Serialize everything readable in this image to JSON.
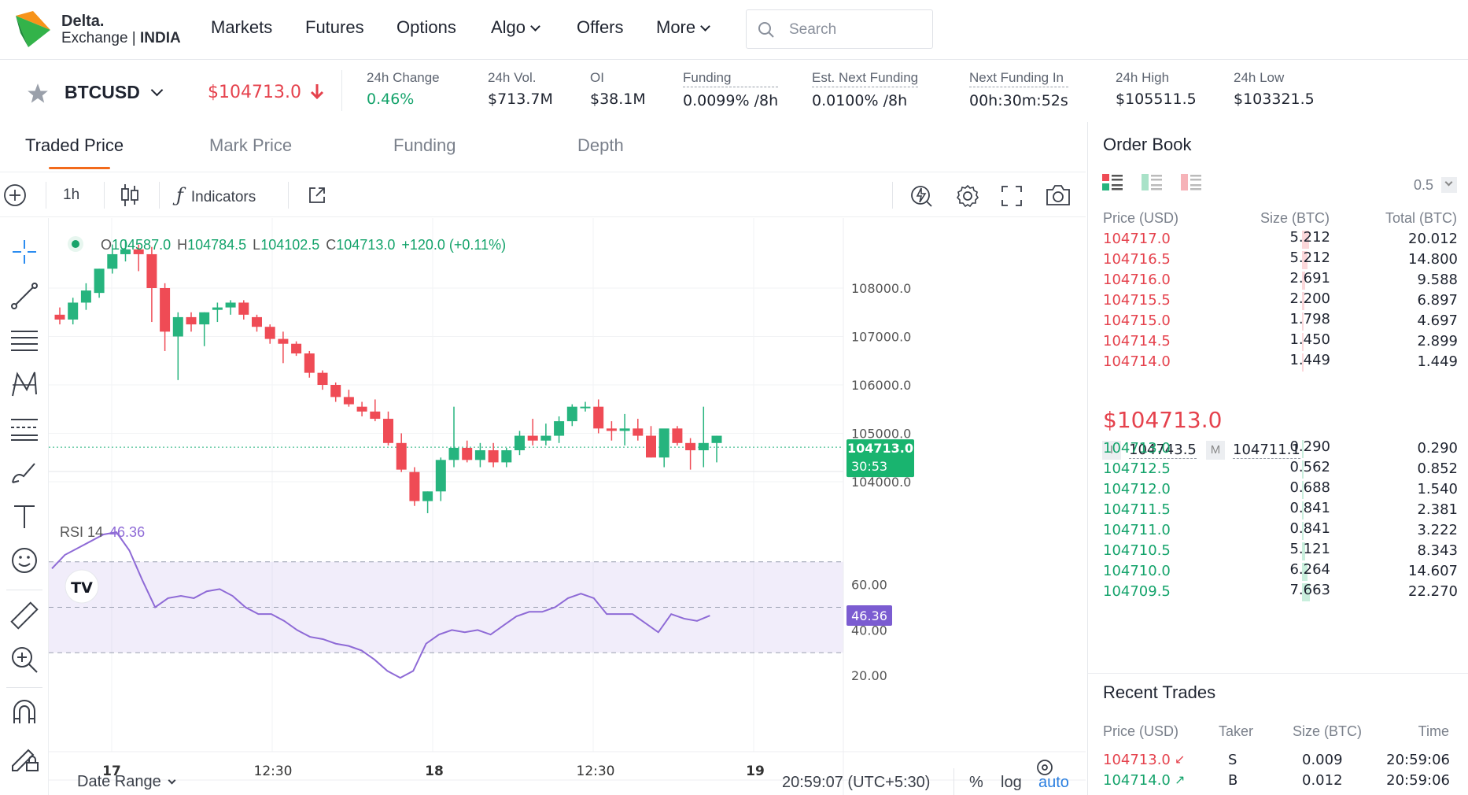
{
  "brand": {
    "line1": "Delta.",
    "line2a": "Exchange",
    "line2b": "INDIA"
  },
  "nav": {
    "items": [
      "Markets",
      "Futures",
      "Options",
      "Algo",
      "Offers",
      "More"
    ],
    "search_placeholder": "Search"
  },
  "ticker": {
    "symbol": "BTCUSD",
    "last_price": "$104713.0",
    "stats": [
      {
        "label": "24h Change",
        "value": "0.46%",
        "value_color": "#14a36b"
      },
      {
        "label": "24h Vol.",
        "value": "$713.7M"
      },
      {
        "label": "OI",
        "value": "$38.1M"
      },
      {
        "label": "Funding",
        "value": "0.0099% /8h",
        "dotted": true
      },
      {
        "label": "Est. Next Funding",
        "value": "0.0100% /8h",
        "dotted": true
      },
      {
        "label": "Next Funding In",
        "value": "00h:30m:52s",
        "dotted": true
      },
      {
        "label": "24h High",
        "value": "$105511.5"
      },
      {
        "label": "24h Low",
        "value": "$103321.5"
      }
    ]
  },
  "chart_tabs": [
    "Traded Price",
    "Mark Price",
    "Funding",
    "Depth"
  ],
  "toolbar": {
    "interval": "1h",
    "indicators": "Indicators"
  },
  "legend": {
    "o_label": "O",
    "o": "104587.0",
    "h_label": "H",
    "h": "104784.5",
    "l_label": "L",
    "l": "104102.5",
    "c_label": "C",
    "c": "104713.0",
    "chg": "+120.0 (+0.11%)"
  },
  "rsi": {
    "label": "RSI 14",
    "value": "46.36"
  },
  "price_axis": {
    "ticks": [
      "108000.0",
      "107000.0",
      "106000.0",
      "105000.0",
      "104000.0"
    ],
    "current": "104713.0",
    "countdown": "30:53"
  },
  "rsi_axis": {
    "ticks": [
      "60.00",
      "40.00",
      "20.00"
    ]
  },
  "time_axis": [
    "17",
    "12:30",
    "18",
    "12:30",
    "19"
  ],
  "footer": {
    "date_range": "Date Range",
    "clock": "20:59:07 (UTC+5:30)",
    "pct": "%",
    "log": "log",
    "auto": "auto"
  },
  "colors": {
    "up": "#26b47e",
    "down": "#ef4b55",
    "accent": "#f26a1b",
    "rsi": "#8e6ad6"
  },
  "chart_data": {
    "type": "candlestick",
    "interval": "1h",
    "candles": [
      [
        107450,
        107600,
        107250,
        107350
      ],
      [
        107350,
        107800,
        107250,
        107700
      ],
      [
        107700,
        108100,
        107550,
        107950
      ],
      [
        107900,
        108400,
        107800,
        108400
      ],
      [
        108400,
        108900,
        108300,
        108700
      ],
      [
        108700,
        109000,
        108550,
        108800
      ],
      [
        108800,
        108900,
        108350,
        108700
      ],
      [
        108700,
        108850,
        107300,
        108000
      ],
      [
        108000,
        108100,
        106700,
        107100
      ],
      [
        107000,
        107500,
        106100,
        107400
      ],
      [
        107400,
        107500,
        107100,
        107250
      ],
      [
        107250,
        107500,
        106800,
        107500
      ],
      [
        107550,
        107700,
        107300,
        107600
      ],
      [
        107600,
        107750,
        107450,
        107700
      ],
      [
        107700,
        107750,
        107350,
        107450
      ],
      [
        107400,
        107450,
        107100,
        107200
      ],
      [
        107200,
        107250,
        106850,
        106950
      ],
      [
        106950,
        107100,
        106450,
        106850
      ],
      [
        106850,
        106900,
        106600,
        106650
      ],
      [
        106650,
        106700,
        106150,
        106250
      ],
      [
        106250,
        106300,
        105900,
        106000
      ],
      [
        106000,
        106050,
        105650,
        105750
      ],
      [
        105750,
        105900,
        105550,
        105600
      ],
      [
        105550,
        105650,
        105350,
        105450
      ],
      [
        105450,
        105700,
        105250,
        105300
      ],
      [
        105300,
        105450,
        104750,
        104800
      ],
      [
        104800,
        105000,
        104200,
        104250
      ],
      [
        104200,
        104300,
        103500,
        103600
      ],
      [
        103600,
        103800,
        103350,
        103800
      ],
      [
        103800,
        104500,
        103600,
        104450
      ],
      [
        104450,
        105550,
        104300,
        104700
      ],
      [
        104700,
        104850,
        104400,
        104450
      ],
      [
        104450,
        104800,
        104300,
        104650
      ],
      [
        104650,
        104800,
        104300,
        104400
      ],
      [
        104400,
        104700,
        104300,
        104650
      ],
      [
        104650,
        105050,
        104550,
        104950
      ],
      [
        104950,
        105300,
        104750,
        104850
      ],
      [
        104850,
        105200,
        104750,
        104950
      ],
      [
        104950,
        105350,
        104800,
        105250
      ],
      [
        105250,
        105600,
        105150,
        105550
      ],
      [
        105550,
        105650,
        105450,
        105550
      ],
      [
        105550,
        105700,
        105000,
        105100
      ],
      [
        105100,
        105250,
        104850,
        105050
      ],
      [
        105050,
        105400,
        104750,
        105100
      ],
      [
        105100,
        105300,
        104850,
        104950
      ],
      [
        104950,
        105150,
        104500,
        104500
      ],
      [
        104500,
        105050,
        104300,
        105100
      ],
      [
        105100,
        105150,
        104750,
        104800
      ],
      [
        104800,
        104900,
        104250,
        104650
      ],
      [
        104650,
        105550,
        104300,
        104800
      ],
      [
        104800,
        104950,
        104400,
        104950
      ]
    ],
    "rsi": [
      67,
      73,
      76,
      79,
      82,
      83,
      75,
      62,
      50,
      54,
      55,
      54,
      57,
      58,
      55,
      50,
      47,
      47,
      44,
      40,
      37,
      36,
      34,
      33,
      31,
      27,
      22,
      19,
      22,
      34,
      38,
      40,
      39,
      40,
      38,
      42,
      46,
      48,
      48,
      50,
      54,
      56,
      54,
      47,
      47,
      47,
      43,
      39,
      47,
      45,
      44,
      46.36
    ],
    "x_labels": [
      "17",
      "12:30",
      "18",
      "12:30",
      "19"
    ],
    "y_ticks": [
      104000,
      105000,
      106000,
      107000,
      108000
    ],
    "rsi_ticks": [
      20,
      40,
      60
    ]
  },
  "orderbook": {
    "title": "Order Book",
    "tick": "0.5",
    "headers": [
      "Price (USD)",
      "Size (BTC)",
      "Total (BTC)"
    ],
    "asks": [
      {
        "price": "104717.0",
        "size": "5.212",
        "total": "20.012",
        "depth": 0.9
      },
      {
        "price": "104716.5",
        "size": "5.212",
        "total": "14.800",
        "depth": 0.66
      },
      {
        "price": "104716.0",
        "size": "2.691",
        "total": "9.588",
        "depth": 0.43
      },
      {
        "price": "104715.5",
        "size": "2.200",
        "total": "6.897",
        "depth": 0.31
      },
      {
        "price": "104715.0",
        "size": "1.798",
        "total": "4.697",
        "depth": 0.21
      },
      {
        "price": "104714.5",
        "size": "1.450",
        "total": "2.899",
        "depth": 0.13
      },
      {
        "price": "104714.0",
        "size": "1.449",
        "total": "1.449",
        "depth": 0.06
      }
    ],
    "mid": "$104713.0",
    "index_label": "I",
    "index": "104743.5",
    "mark_label": "M",
    "mark": "104711.1",
    "bids": [
      {
        "price": "104713.0",
        "size": "0.290",
        "total": "0.290",
        "depth": 0.01
      },
      {
        "price": "104712.5",
        "size": "0.562",
        "total": "0.852",
        "depth": 0.04
      },
      {
        "price": "104712.0",
        "size": "0.688",
        "total": "1.540",
        "depth": 0.07
      },
      {
        "price": "104711.5",
        "size": "0.841",
        "total": "2.381",
        "depth": 0.11
      },
      {
        "price": "104711.0",
        "size": "0.841",
        "total": "3.222",
        "depth": 0.14
      },
      {
        "price": "104710.5",
        "size": "5.121",
        "total": "8.343",
        "depth": 0.37
      },
      {
        "price": "104710.0",
        "size": "6.264",
        "total": "14.607",
        "depth": 0.65
      },
      {
        "price": "104709.5",
        "size": "7.663",
        "total": "22.270",
        "depth": 1.0
      }
    ]
  },
  "recent_trades": {
    "title": "Recent Trades",
    "headers": [
      "Price (USD)",
      "Taker",
      "Size (BTC)",
      "Time"
    ],
    "rows": [
      {
        "price": "104713.0",
        "taker": "S",
        "size": "0.009",
        "time": "20:59:06",
        "side": "sell"
      },
      {
        "price": "104714.0",
        "taker": "B",
        "size": "0.012",
        "time": "20:59:06",
        "side": "buy"
      }
    ]
  }
}
